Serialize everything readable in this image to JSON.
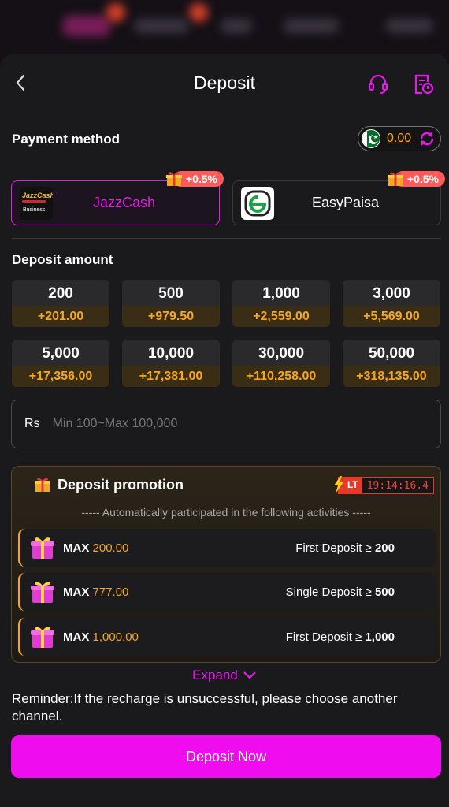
{
  "header": {
    "title": "Deposit",
    "back_icon": "chevron-left-icon",
    "support_icon": "headset-icon",
    "history_icon": "history-icon"
  },
  "payment": {
    "section_title": "Payment method",
    "balance": "0.00",
    "methods": [
      {
        "label": "JazzCash",
        "bonus": "+0.5%",
        "active": true,
        "logo_text": "JazzCash",
        "logo_sub": "Business"
      },
      {
        "label": "EasyPaisa",
        "bonus": "+0.5%",
        "active": false
      }
    ]
  },
  "amounts": {
    "section_title": "Deposit amount",
    "items": [
      {
        "amount": "200",
        "bonus": "+201.00"
      },
      {
        "amount": "500",
        "bonus": "+979.50"
      },
      {
        "amount": "1,000",
        "bonus": "+2,559.00"
      },
      {
        "amount": "3,000",
        "bonus": "+5,569.00"
      },
      {
        "amount": "5,000",
        "bonus": "+17,356.00"
      },
      {
        "amount": "10,000",
        "bonus": "+17,381.00"
      },
      {
        "amount": "30,000",
        "bonus": "+110,258.00"
      },
      {
        "amount": "50,000",
        "bonus": "+318,135.00"
      }
    ]
  },
  "input": {
    "currency": "Rs",
    "placeholder": "Min 100~Max 100,000"
  },
  "promotion": {
    "title": "Deposit promotion",
    "lt_tag": "LT",
    "countdown": "19:14:16.4",
    "subtitle": "----- Automatically participated in the following activities -----",
    "rows": [
      {
        "max_label": "MAX",
        "max_value": "200.00",
        "condition": "First Deposit ≥",
        "threshold": "200"
      },
      {
        "max_label": "MAX",
        "max_value": "777.00",
        "condition": "Single Deposit ≥",
        "threshold": "500"
      },
      {
        "max_label": "MAX",
        "max_value": "1,000.00",
        "condition": "First Deposit ≥",
        "threshold": "1,000"
      }
    ],
    "expand_label": "Expand"
  },
  "reminder": "Reminder:If the recharge is unsuccessful, please choose another channel.",
  "cta_label": "Deposit Now",
  "colors": {
    "accent": "#ef0df0",
    "gold": "#f5a623",
    "bonus_badge": "#ff5a5a"
  }
}
